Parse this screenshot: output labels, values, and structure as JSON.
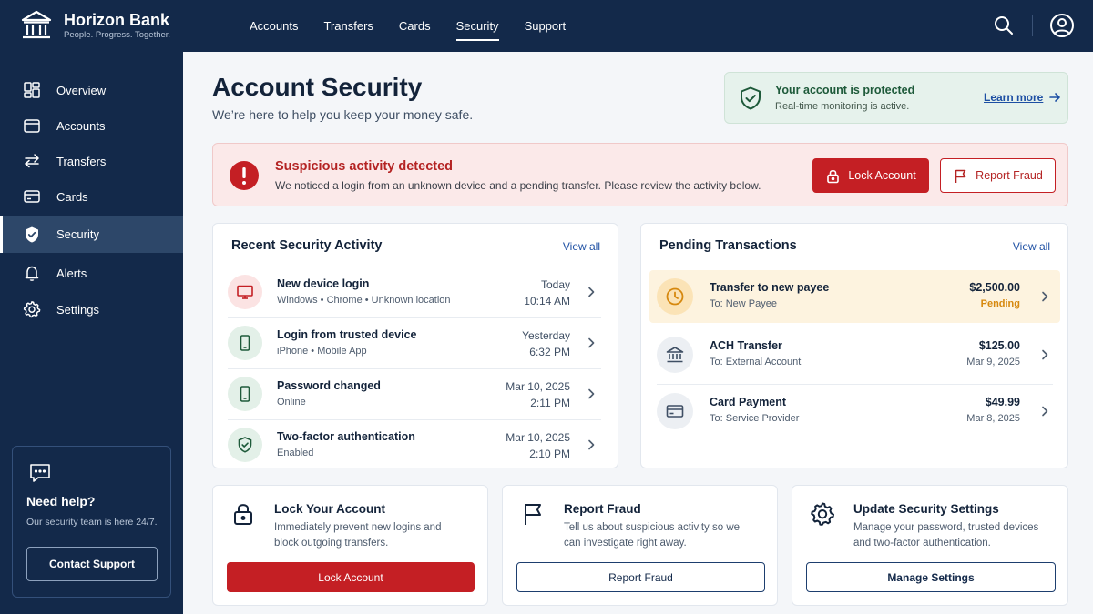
{
  "brand": {
    "name": "Horizon Bank",
    "tagline": "People. Progress. Together."
  },
  "topnav": {
    "items": [
      {
        "label": "Accounts",
        "active": false
      },
      {
        "label": "Transfers",
        "active": false
      },
      {
        "label": "Cards",
        "active": false
      },
      {
        "label": "Security",
        "active": true
      },
      {
        "label": "Support",
        "active": false
      }
    ],
    "icons": [
      "search-icon",
      "user-icon"
    ]
  },
  "sidebar": {
    "items": [
      {
        "label": "Overview",
        "icon": "grid-icon",
        "active": false
      },
      {
        "label": "Accounts",
        "icon": "wallet-icon",
        "active": false
      },
      {
        "label": "Transfers",
        "icon": "transfer-icon",
        "active": false
      },
      {
        "label": "Cards",
        "icon": "card-icon",
        "active": false
      },
      {
        "label": "Security",
        "icon": "shield-icon",
        "active": true
      },
      {
        "label": "Alerts",
        "icon": "bell-icon",
        "active": false
      },
      {
        "label": "Settings",
        "icon": "gear-icon",
        "active": false
      }
    ],
    "help": {
      "title": "Need help?",
      "subtitle": "Our security team is here 24/7.",
      "button": "Contact Support"
    }
  },
  "page": {
    "title": "Account Security",
    "subtitle": "We’re here to help you keep your money safe."
  },
  "protection": {
    "title": "Your account is protected",
    "subtitle": "Real-time monitoring is active.",
    "link": "Learn more"
  },
  "alert": {
    "title": "Suspicious activity detected",
    "message": "We noticed a login from an unknown device and a pending transfer. Please review the activity below.",
    "lock_button": "Lock Account",
    "report_button": "Report Fraud"
  },
  "activity": {
    "title": "Recent Security Activity",
    "view_all": "View all",
    "items": [
      {
        "title": "New device login",
        "detail": "Windows • Chrome • Unknown location",
        "date": "Today",
        "time": "10:14 AM",
        "icon": "monitor-icon",
        "tone": "danger"
      },
      {
        "title": "Login from trusted device",
        "detail": "iPhone • Mobile App",
        "date": "Yesterday",
        "time": "6:32 PM",
        "icon": "phone-icon",
        "tone": "safe"
      },
      {
        "title": "Password changed",
        "detail": "Online",
        "date": "Mar 10, 2025",
        "time": "2:11 PM",
        "icon": "phone-icon",
        "tone": "safe"
      },
      {
        "title": "Two-factor authentication",
        "detail": "Enabled",
        "date": "Mar 10, 2025",
        "time": "2:10 PM",
        "icon": "shield-check-icon",
        "tone": "safe"
      }
    ]
  },
  "pending": {
    "title": "Pending Transactions",
    "view_all": "View all",
    "items": [
      {
        "title": "Transfer to new payee",
        "to": "To: New Payee",
        "amount": "$2,500.00",
        "status": "Pending",
        "icon": "clock-icon"
      },
      {
        "title": "ACH Transfer",
        "to": "To: External Account",
        "amount": "$125.00",
        "status": "Mar 9, 2025",
        "icon": "bank-icon"
      },
      {
        "title": "Card Payment",
        "to": "To: Service Provider",
        "amount": "$49.99",
        "status": "Mar 8, 2025",
        "icon": "card-icon"
      }
    ]
  },
  "quick_actions": [
    {
      "title": "Lock Your Account",
      "description": "Immediately prevent new logins and block outgoing transfers.",
      "button": "Lock Account",
      "icon": "lock-icon"
    },
    {
      "title": "Report Fraud",
      "description": "Tell us about suspicious activity so we can investigate right away.",
      "button": "Report Fraud",
      "icon": "flag-icon"
    },
    {
      "title": "Update Security Settings",
      "description": "Manage your password, trusted devices and two-factor authentication.",
      "button": "Manage Settings",
      "icon": "gear-icon"
    }
  ],
  "colors": {
    "navy": "#13294a",
    "danger": "#c41f24",
    "success": "#1e5a3a",
    "link": "#1d4fa3",
    "pending": "#d6880e"
  }
}
